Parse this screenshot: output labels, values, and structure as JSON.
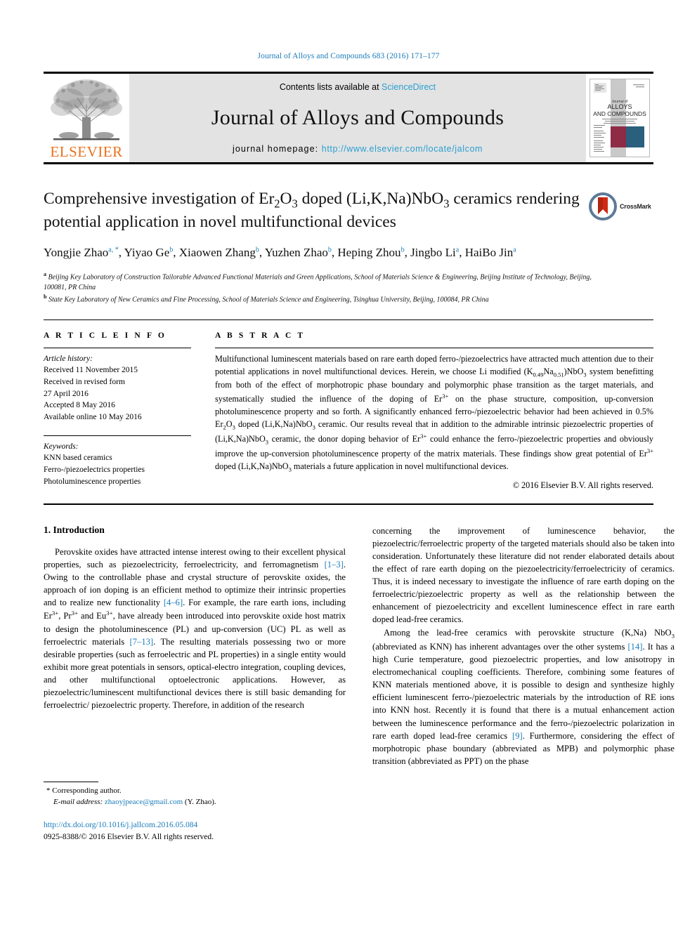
{
  "running_head": "Journal of Alloys and Compounds 683 (2016) 171–177",
  "masthead": {
    "publisher": "ELSEVIER",
    "contents_prefix": "Contents lists available at ",
    "contents_link": "ScienceDirect",
    "journal_title": "Journal of Alloys and Compounds",
    "homepage_prefix": "journal homepage: ",
    "homepage_url": "http://www.elsevier.com/locate/jalcom",
    "cover": {
      "line1": "Journal of",
      "line2": "ALLOYS",
      "line3": "AND COMPOUNDS",
      "maroon": "#8e2c45",
      "teal": "#2a5f7d",
      "band": "#c9c9c9"
    },
    "accent_link_color": "#2a9fd0",
    "elsevier_orange": "#E9711C"
  },
  "article": {
    "title_line1": "Comprehensive investigation of Er",
    "title_full": "Comprehensive investigation of Er2O3 doped (Li,K,Na)NbO3 ceramics rendering potential application in novel multifunctional devices",
    "crossmark_label": "CrossMark",
    "authors": [
      {
        "name": "Yongjie Zhao",
        "sup": "a, *"
      },
      {
        "name": "Yiyao Ge",
        "sup": "b"
      },
      {
        "name": "Xiaowen Zhang",
        "sup": "b"
      },
      {
        "name": "Yuzhen Zhao",
        "sup": "b"
      },
      {
        "name": "Heping Zhou",
        "sup": "b"
      },
      {
        "name": "Jingbo Li",
        "sup": "a"
      },
      {
        "name": "HaiBo Jin",
        "sup": "a"
      }
    ],
    "affiliations": [
      {
        "mark": "a",
        "text": "Beijing Key Laboratory of Construction Tailorable Advanced Functional Materials and Green Applications, School of Materials Science & Engineering, Beijing Institute of Technology, Beijing, 100081, PR China"
      },
      {
        "mark": "b",
        "text": "State Key Laboratory of New Ceramics and Fine Processing, School of Materials Science and Engineering, Tsinghua University, Beijing, 100084, PR China"
      }
    ]
  },
  "article_info": {
    "heading": "A R T I C L E  I N F O",
    "history_label": "Article history:",
    "history": [
      "Received 11 November 2015",
      "Received in revised form",
      "27 April 2016",
      "Accepted 8 May 2016",
      "Available online 10 May 2016"
    ],
    "keywords_label": "Keywords:",
    "keywords": [
      "KNN based ceramics",
      "Ferro-/piezoelectrics properties",
      "Photoluminescence properties"
    ]
  },
  "abstract": {
    "heading": "A B S T R A C T",
    "copyright": "© 2016 Elsevier B.V. All rights reserved."
  },
  "introduction": {
    "heading": "1.  Introduction"
  },
  "footnote": {
    "corresponding": "Corresponding author.",
    "email_label": "E-mail address:",
    "email": "zhaoyjpeace@gmail.com",
    "email_suffix": "(Y. Zhao)."
  },
  "doi_block": {
    "doi": "http://dx.doi.org/10.1016/j.jallcom.2016.05.084",
    "issn_line": "0925-8388/© 2016 Elsevier B.V. All rights reserved."
  }
}
